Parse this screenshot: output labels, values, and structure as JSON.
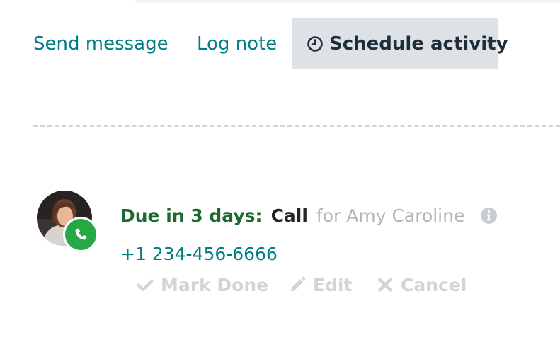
{
  "chatter": {
    "send_message": "Send message",
    "log_note": "Log note",
    "schedule_activity": "Schedule activity"
  },
  "activity": {
    "due": "Due in 3 days:",
    "type": "Call",
    "assignee": "for Amy Caroline",
    "phone": "+1 234-456-6666",
    "actions": {
      "mark_done": "Mark Done",
      "edit": "Edit",
      "cancel": "Cancel"
    }
  },
  "colors": {
    "accent": "#017e84",
    "due_green": "#1b6b2f",
    "call_badge": "#28a745",
    "muted": "#adb5bd",
    "button_active_bg": "#dee2e6"
  }
}
